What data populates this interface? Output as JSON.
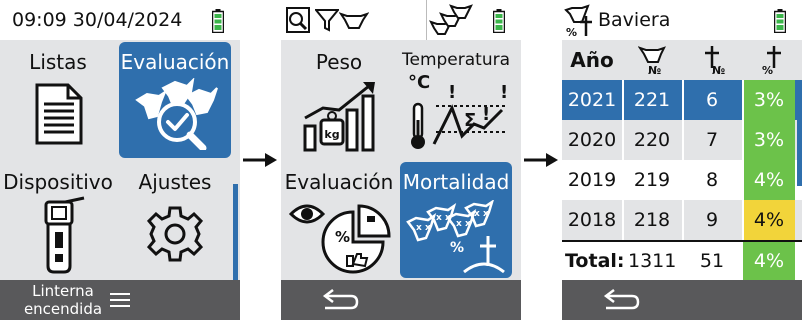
{
  "screen1": {
    "datetime": "09:09 30/04/2024",
    "tiles": [
      {
        "label": "Listas"
      },
      {
        "label": "Evaluación"
      },
      {
        "label": "Dispositivo"
      },
      {
        "label": "Ajustes"
      }
    ],
    "footer_label_line1": "Linterna",
    "footer_label_line2": "encendida"
  },
  "screen2": {
    "tiles": [
      {
        "label": "Peso"
      },
      {
        "label": "Temperatura",
        "unit": "°C"
      },
      {
        "label": "Evaluación"
      },
      {
        "label": "Mortalidad"
      }
    ]
  },
  "screen3": {
    "title": "Baviera",
    "header": {
      "year": "Año"
    },
    "rows": [
      {
        "year": "2021",
        "count": "221",
        "deaths": "6",
        "rate": "3%",
        "rate_color": "#6cc24a"
      },
      {
        "year": "2020",
        "count": "220",
        "deaths": "7",
        "rate": "3%",
        "rate_color": "#6cc24a"
      },
      {
        "year": "2019",
        "count": "219",
        "deaths": "8",
        "rate": "4%",
        "rate_color": "#6cc24a"
      },
      {
        "year": "2018",
        "count": "218",
        "deaths": "9",
        "rate": "4%",
        "rate_color": "#f2d43a"
      }
    ],
    "total_label": "Total:",
    "total_count": "1311",
    "total_deaths": "51",
    "total_rate": "4%"
  },
  "colors": {
    "accent_blue": "#2f6fad",
    "footer_gray": "#59595b",
    "panel_gray": "#e3e4e6",
    "battery_green": "#3bb54a",
    "rate_green": "#6cc24a",
    "rate_yellow": "#f2d43a"
  }
}
